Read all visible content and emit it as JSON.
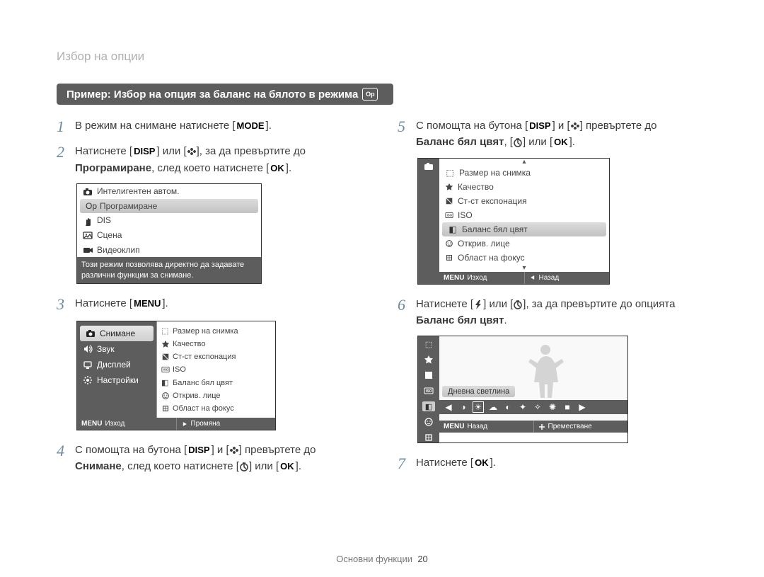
{
  "header": "Избор на опции",
  "banner": "Пример: Избор на опция за баланс на бялото в режима",
  "steps": {
    "s1": {
      "num": "1",
      "a": "В режим на снимане натиснете [",
      "b": "].",
      "key": "MODE"
    },
    "s2": {
      "num": "2",
      "a": "Натиснете [",
      "b": "] или [",
      "c": "], за да превъртите до",
      "bold1": "Програмиране",
      "d": ", след което натиснете [",
      "e": "].",
      "k_ok": "OK"
    },
    "s3": {
      "num": "3",
      "a": "Натиснете [",
      "b": "].",
      "key": "MENU"
    },
    "s4": {
      "num": "4",
      "a": "С помощта на бутона [",
      "b": "] и [",
      "c": "] превъртете до",
      "bold1": "Снимане",
      "d": ", след което натиснете [",
      "e": "] или [",
      "f": "].",
      "k_ok": "OK"
    },
    "s5": {
      "num": "5",
      "a": "С помощта на бутона [",
      "b": "] и [",
      "c": "] превъртете до",
      "bold1": "Баланс бял цвят",
      "d": ", [",
      "e": "] или [",
      "f": "].",
      "k_ok": "OK"
    },
    "s6": {
      "num": "6",
      "a": "Натиснете [",
      "b": "] или [",
      "c": "], за да превъртите до опцията",
      "bold1": "Баланс бял цвят",
      "d": "."
    },
    "s7": {
      "num": "7",
      "a": "Натиснете [",
      "b": "].",
      "k_ok": "OK"
    }
  },
  "screen1": {
    "items": [
      "Интелигентен автом.",
      "Програмиране",
      "DIS",
      "Сцена",
      "Видеоклип"
    ],
    "hint": "Този режим позволява директно да задавате различни функции за снимане."
  },
  "screen2": {
    "tabs": [
      "Снимане",
      "Звук",
      "Дисплей",
      "Настройки"
    ],
    "options": [
      "Размер на снимка",
      "Качество",
      "Ст-ст експонация",
      "ISO",
      "Баланс бял цвят",
      "Открив. лице",
      "Област на фокус"
    ],
    "foot_left_key": "MENU",
    "foot_left": "Изход",
    "foot_right": "Промяна"
  },
  "screen3": {
    "options": [
      "Размер на снимка",
      "Качество",
      "Ст-ст експонация",
      "ISO",
      "Баланс бял цвят",
      "Открив. лице",
      "Област на фокус"
    ],
    "foot_left_key": "MENU",
    "foot_left": "Изход",
    "foot_right": "Назад"
  },
  "screen4": {
    "label": "Дневна светлина",
    "foot_left_key": "MENU",
    "foot_left": "Назад",
    "foot_right": "Преместване"
  },
  "footer": {
    "label": "Основни функции",
    "page": "20"
  }
}
